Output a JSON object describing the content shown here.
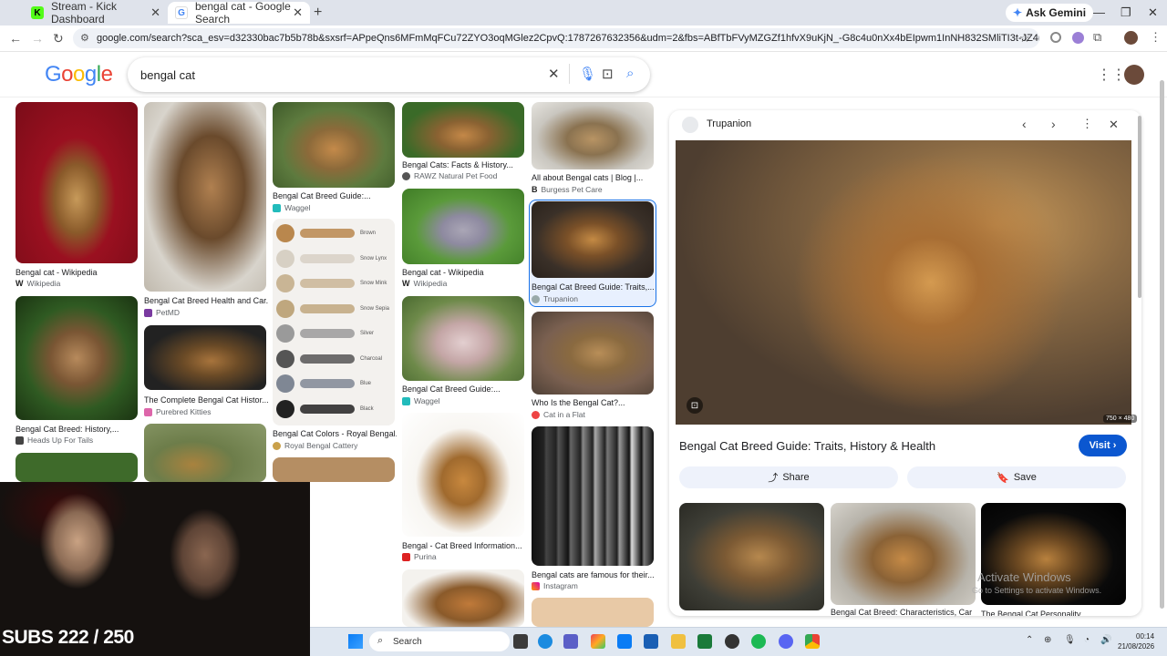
{
  "browser": {
    "tabs": [
      {
        "label": "Stream - Kick Dashboard"
      },
      {
        "label": "bengal cat - Google Search"
      }
    ],
    "gemini_label": "Ask Gemini",
    "url": "google.com/search?sca_esv=d32330bac7b5b78b&sxsrf=APpeQns6MFmMqFCu72ZYO3oqMGlez2CpvQ:1787267632356&udm=2&fbs=ABfTbFVyMZGZf1hfvX9uKjN_-G8c4u0nXx4bEIpwm1InNH832SMliTI3t-JZ4hGJOxPbHYRQDtz5om-6srRFNP4..."
  },
  "search": {
    "logo": "Google",
    "query": "bengal cat"
  },
  "results": [
    {
      "caption": "Bengal cat - Wikipedia",
      "source": "Wikipedia"
    },
    {
      "caption": "Bengal Cat Breed: History,...",
      "source": "Heads Up For Tails"
    },
    {
      "caption": "Bengal Cat Breed Health and Car...",
      "source": "PetMD"
    },
    {
      "caption": "The Complete Bengal Cat Histor...",
      "source": "Purebred Kitties"
    },
    {
      "caption": "Bengal Cat Breed Guide:...",
      "source": "Waggel"
    },
    {
      "caption": "Bengal Cat Colors - Royal Bengal...",
      "source": "Royal Bengal Cattery"
    },
    {
      "caption": "Bengal Cats: Facts & History...",
      "source": "RAWZ Natural Pet Food"
    },
    {
      "caption": "Bengal cat - Wikipedia",
      "source": "Wikipedia"
    },
    {
      "caption": "Bengal Cat Breed Guide:...",
      "source": "Waggel"
    },
    {
      "caption": "Bengal - Cat Breed Information...",
      "source": "Purina"
    },
    {
      "caption": "All about Bengal cats | Blog |...",
      "source": "Burgess Pet Care"
    },
    {
      "caption": "Bengal Cat Breed Guide: Traits,...",
      "source": "Trupanion"
    },
    {
      "caption": "Who Is the Bengal Cat?...",
      "source": "Cat in a Flat"
    },
    {
      "caption": "Bengal cats are famous for their...",
      "source": "Instagram"
    }
  ],
  "chart_grid_labels": [
    "Brown",
    "Snow Lynx",
    "Snow Mink",
    "Snow Sepia",
    "Silver",
    "Charcoal",
    "Blue",
    "Black"
  ],
  "panel": {
    "source": "Trupanion",
    "dims": "750 × 480",
    "title": "Bengal Cat Breed Guide: Traits, History & Health",
    "visit": "Visit",
    "share": "Share",
    "save": "Save",
    "related_caption": "Bengal Cat Breed: Characteristics, Car...",
    "related_caption2": "The Bengal Cat Personality...",
    "watermark1": "Activate Windows",
    "watermark2": "Go to Settings to activate Windows."
  },
  "overlay": {
    "subs": "SUBS 222 / 250"
  },
  "taskbar": {
    "search": "Search",
    "time": "00:14",
    "date": "21/08/2026"
  },
  "colors": {
    "accent": "#0b57d0",
    "selected": "#e8f0fe"
  }
}
